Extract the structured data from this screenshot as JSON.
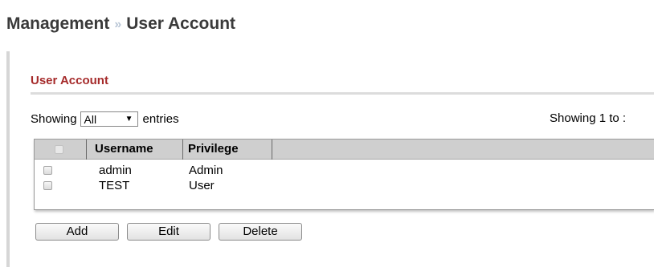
{
  "header": {
    "breadcrumb_parent": "Management",
    "breadcrumb_separator": "»",
    "breadcrumb_current": "User Account"
  },
  "section": {
    "title": "User Account"
  },
  "entries": {
    "prefix": "Showing",
    "selected": "All",
    "suffix": "entries",
    "summary": "Showing 1 to :"
  },
  "table": {
    "columns": [
      "",
      "Username",
      "Privilege"
    ],
    "rows": [
      {
        "username": "admin",
        "privilege": "Admin",
        "checked": false
      },
      {
        "username": "TEST",
        "privilege": "User",
        "checked": false
      }
    ]
  },
  "actions": {
    "add": "Add",
    "edit": "Edit",
    "delete": "Delete"
  },
  "colors": {
    "accent_red": "#a52a2a",
    "header_bg": "#cfcfcf"
  }
}
